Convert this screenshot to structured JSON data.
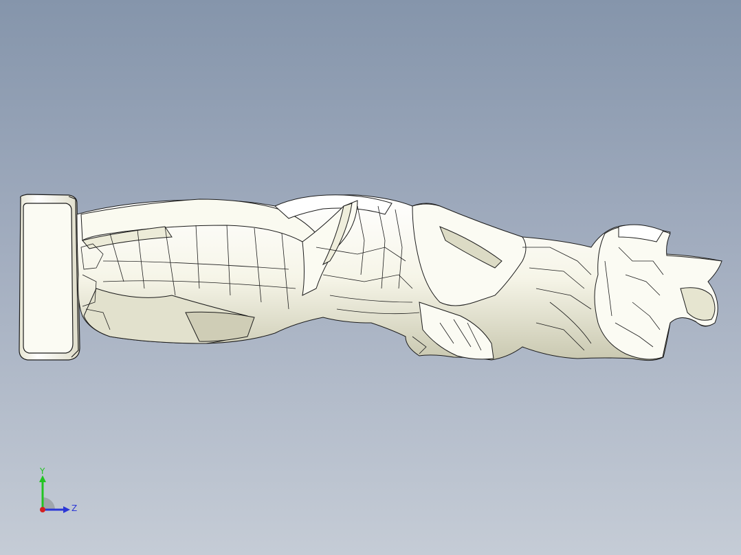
{
  "viewport": {
    "background_top": "#8595ab",
    "background_bottom": "#c5ccd6"
  },
  "model": {
    "fill": "#f5f4e6",
    "shade": "#d9d8c2",
    "edge": "#1a1a1a"
  },
  "triad": {
    "y_label": "Y",
    "z_label": "Z",
    "y_color": "#22c422",
    "z_color": "#2b36d6",
    "x_color": "#d42020"
  }
}
